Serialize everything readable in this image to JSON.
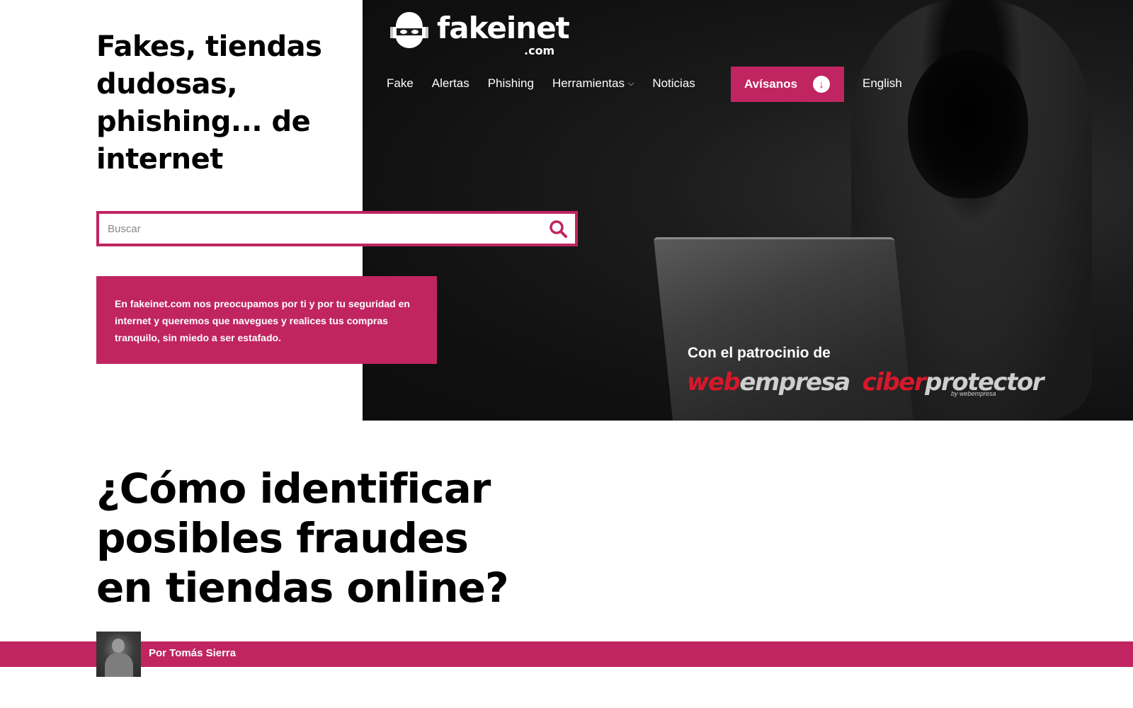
{
  "brand": {
    "name": "fakeinet",
    "tld": ".com"
  },
  "nav": {
    "items": [
      {
        "label": "Fake"
      },
      {
        "label": "Alertas"
      },
      {
        "label": "Phishing"
      },
      {
        "label": "Herramientas",
        "has_dropdown": true
      },
      {
        "label": "Noticias"
      }
    ],
    "alert_button": "Avísanos",
    "language": "English"
  },
  "hero": {
    "headline": "Fakes, tiendas dudosas, phishing... de internet",
    "info_text": "En fakeinet.com nos preocupamos por ti y por tu seguridad en internet y queremos que navegues y realices tus compras tranquilo, sin miedo a ser estafado."
  },
  "search": {
    "placeholder": "Buscar",
    "value": ""
  },
  "sponsors": {
    "title": "Con el patrocinio de",
    "logo1_part1": "web",
    "logo1_part2": "empresa",
    "logo2_part1": "ciber",
    "logo2_part2": "protector",
    "logo2_byline": "by webempresa"
  },
  "article": {
    "title": "¿Cómo identificar posibles fraudes en tiendas online?",
    "author": "Por Tomás Sierra"
  },
  "colors": {
    "accent": "#c02561",
    "hero_bg": "#1a1a1a",
    "sponsor_red": "#d7182a"
  }
}
